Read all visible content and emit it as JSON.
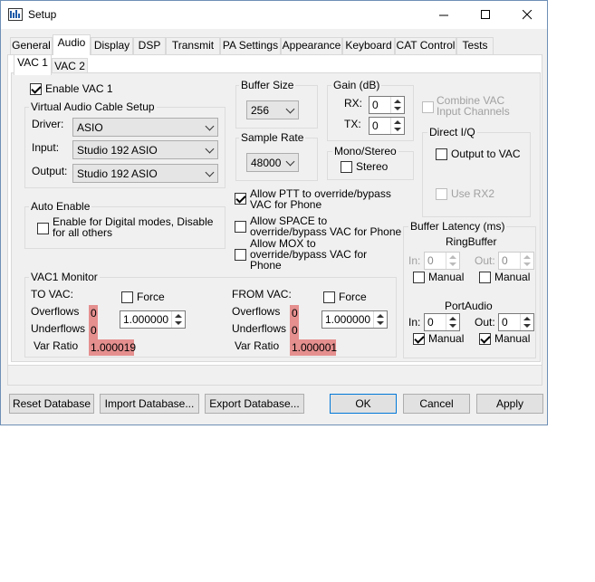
{
  "window": {
    "title": "Setup"
  },
  "tabs": [
    "General",
    "Audio",
    "Display",
    "DSP",
    "Transmit",
    "PA Settings",
    "Appearance",
    "Keyboard",
    "CAT Control",
    "Tests"
  ],
  "subtabs": [
    "VAC 1",
    "VAC 2"
  ],
  "vac": {
    "enable_label": "Enable VAC 1",
    "cable_setup_title": "Virtual Audio Cable Setup",
    "driver_label": "Driver:",
    "driver_value": "ASIO",
    "input_label": "Input:",
    "input_value": "Studio 192 ASIO",
    "output_label": "Output:",
    "output_value": "Studio 192 ASIO"
  },
  "buffer_size": {
    "title": "Buffer Size",
    "value": "256"
  },
  "sample_rate": {
    "title": "Sample Rate",
    "value": "48000"
  },
  "gain": {
    "title": "Gain (dB)",
    "rx_label": "RX:",
    "rx_value": "0",
    "tx_label": "TX:",
    "tx_value": "0"
  },
  "mono_stereo": {
    "title": "Mono/Stereo",
    "stereo_label": "Stereo"
  },
  "combine_vac": {
    "line1": "Combine VAC",
    "line2": "Input Channels"
  },
  "direct_iq": {
    "title": "Direct I/Q",
    "output_label": "Output to VAC",
    "use_rx2_label": "Use RX2"
  },
  "auto_enable": {
    "title": "Auto Enable",
    "line1": "Enable for Digital modes, Disable",
    "line2": "for all others"
  },
  "allow": {
    "ptt_line1": "Allow PTT to override/bypass",
    "ptt_line2": "VAC for Phone",
    "space_line1": "Allow SPACE to",
    "space_line2": "override/bypass VAC for Phone",
    "mox_line1": "Allow MOX to",
    "mox_line2": "override/bypass VAC for",
    "mox_line3": "Phone"
  },
  "monitor": {
    "title": "VAC1 Monitor",
    "to_vac": {
      "label": "TO VAC:",
      "force_label": "Force",
      "overflows_label": "Overflows",
      "overflows_value": "0",
      "underflows_label": "Underflows",
      "underflows_value": "0",
      "var_ratio_label": "Var Ratio",
      "var_ratio_value": "1.000019",
      "spin_value": "1.000000"
    },
    "from_vac": {
      "label": "FROM VAC:",
      "force_label": "Force",
      "overflows_label": "Overflows",
      "overflows_value": "0",
      "underflows_label": "Underflows",
      "underflows_value": "0",
      "var_ratio_label": "Var Ratio",
      "var_ratio_value": "1.000001",
      "spin_value": "1.000000"
    }
  },
  "buffer_latency": {
    "title": "Buffer Latency (ms)",
    "ringbuffer_title": "RingBuffer",
    "rb_in_label": "In:",
    "rb_in_value": "0",
    "rb_out_label": "Out:",
    "rb_out_value": "0",
    "rb_manual_in": "Manual",
    "rb_manual_out": "Manual",
    "portaudio_title": "PortAudio",
    "pa_in_label": "In:",
    "pa_in_value": "0",
    "pa_out_label": "Out:",
    "pa_out_value": "0",
    "pa_manual_in": "Manual",
    "pa_manual_out": "Manual"
  },
  "buttons": {
    "reset": "Reset Database",
    "import": "Import Database...",
    "export": "Export Database...",
    "ok": "OK",
    "cancel": "Cancel",
    "apply": "Apply"
  }
}
